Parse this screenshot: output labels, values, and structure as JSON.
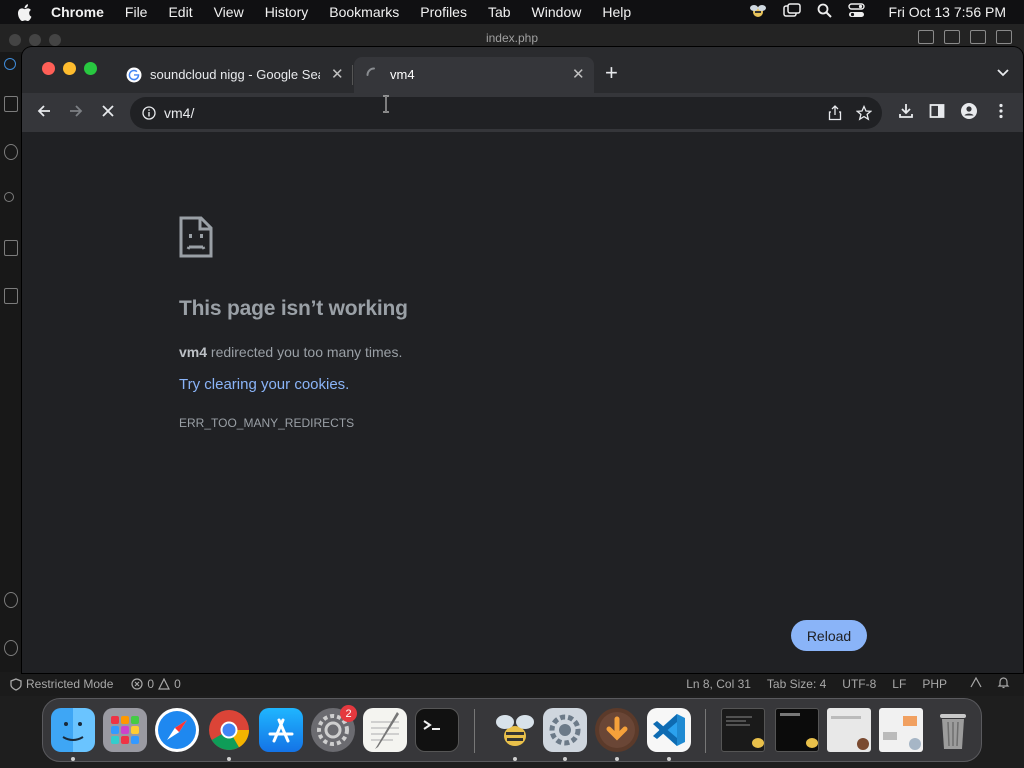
{
  "menubar": {
    "app": "Chrome",
    "items": [
      "File",
      "Edit",
      "View",
      "History",
      "Bookmarks",
      "Profiles",
      "Tab",
      "Window",
      "Help"
    ],
    "clock": "Fri Oct 13  7:56 PM"
  },
  "vscode": {
    "window_title": "index.php",
    "status": {
      "restricted": "Restricted Mode",
      "errors": "0",
      "warnings": "0",
      "position": "Ln 8, Col 31",
      "tab_size": "Tab Size: 4",
      "encoding": "UTF-8",
      "eol": "LF",
      "language": "PHP"
    }
  },
  "chrome": {
    "tabs": [
      {
        "title": "soundcloud nigg - Google Search",
        "active": false
      },
      {
        "title": "vm4",
        "active": true
      }
    ],
    "url": "vm4/",
    "error": {
      "title": "This page isn’t working",
      "host": "vm4",
      "desc_rest": " redirected you too many times.",
      "link": "Try clearing your cookies.",
      "code": "ERR_TOO_MANY_REDIRECTS",
      "reload": "Reload"
    }
  },
  "dock": {
    "items": [
      "finder-icon",
      "launchpad-icon",
      "safari-icon",
      "chrome-icon",
      "app-store-icon",
      "system-settings-icon",
      "textedit-icon",
      "terminal-icon",
      "cyberduck-icon",
      "settings-icon",
      "download-icon",
      "vscode-icon",
      "window-thumbnail-icon",
      "window-thumbnail-icon",
      "window-thumbnail-icon",
      "window-thumbnail-icon",
      "trash-icon"
    ],
    "badge": "2"
  },
  "colors": {
    "accent": "#8ab4f8",
    "close": "#ff5f57",
    "minimize": "#febc2e",
    "maximize": "#28c840"
  }
}
